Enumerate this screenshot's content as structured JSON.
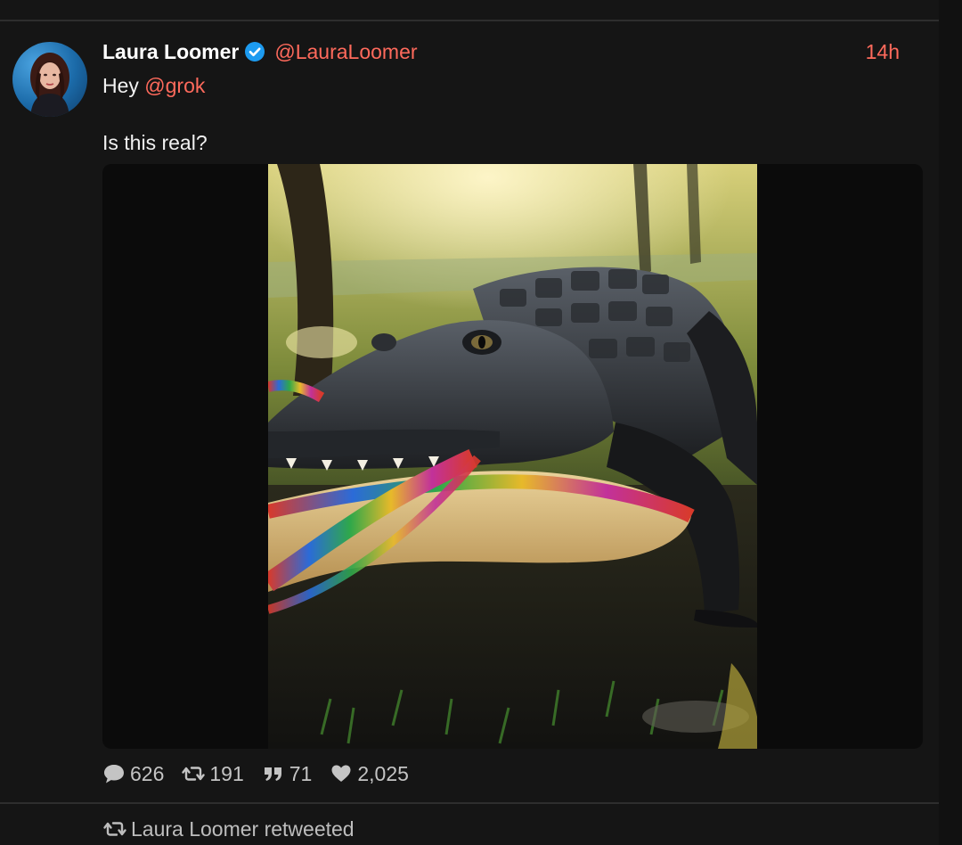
{
  "colors": {
    "background": "#151515",
    "accent": "#ff6a5c",
    "verified": "#1d9bf0",
    "muted_text": "#bdbdbd",
    "divider": "#2e2e2e"
  },
  "tweet": {
    "author_name": "Laura Loomer",
    "verified_icon": "verified-badge-icon",
    "handle": "@LauraLoomer",
    "timestamp": "14h",
    "text_prefix": "Hey ",
    "mention": "@grok",
    "text_line2": "Is this real?",
    "media_icon": "alligator-with-sombrero-photo",
    "stats": {
      "replies": "626",
      "retweets": "191",
      "quotes": "71",
      "likes": "2,025"
    }
  },
  "next_item": {
    "retweet_label": "Laura Loomer retweeted",
    "icon": "retweet-icon"
  }
}
